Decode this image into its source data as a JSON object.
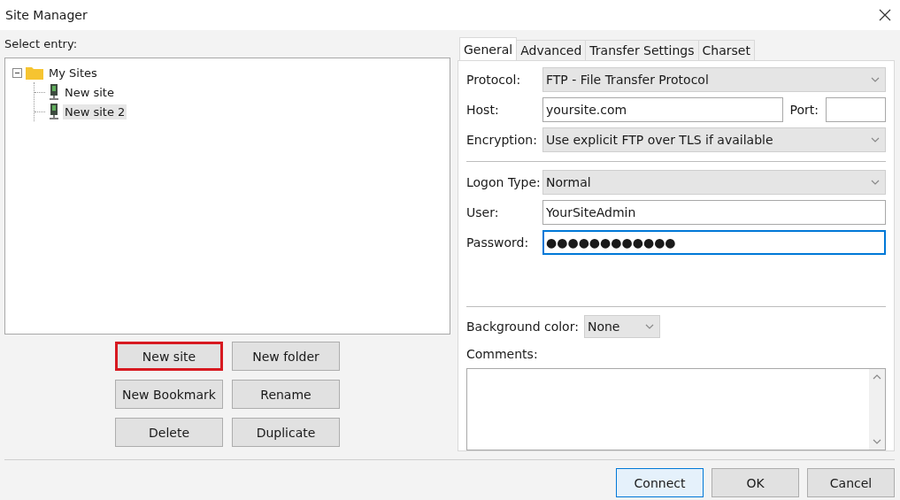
{
  "window": {
    "title": "Site Manager"
  },
  "tree": {
    "label": "Select entry:",
    "items": [
      {
        "label": "My Sites",
        "kind": "folder",
        "expanded": true,
        "selected": false,
        "children": [
          {
            "label": "New site",
            "kind": "site",
            "selected": false
          },
          {
            "label": "New site 2",
            "kind": "site",
            "selected": true
          }
        ]
      }
    ]
  },
  "entry_buttons": [
    {
      "label": "New site",
      "highlighted": true
    },
    {
      "label": "New folder",
      "highlighted": false
    },
    {
      "label": "New Bookmark",
      "highlighted": false
    },
    {
      "label": "Rename",
      "highlighted": false
    },
    {
      "label": "Delete",
      "highlighted": false
    },
    {
      "label": "Duplicate",
      "highlighted": false
    }
  ],
  "tabs": [
    {
      "label": "General",
      "selected": true
    },
    {
      "label": "Advanced",
      "selected": false
    },
    {
      "label": "Transfer Settings",
      "selected": false
    },
    {
      "label": "Charset",
      "selected": false
    }
  ],
  "server_fields": [
    {
      "label": "Protocol:",
      "kind": "select",
      "value": "FTP - File Transfer Protocol"
    },
    {
      "label": "Host:",
      "kind": "input",
      "value": "yoursite.com",
      "extra_label": "Port:"
    },
    {
      "label": "Encryption:",
      "kind": "select",
      "value": "Use explicit FTP over TLS if available"
    }
  ],
  "logon_fields": [
    {
      "label": "Logon Type:",
      "kind": "select",
      "value": "Normal"
    },
    {
      "label": "User:",
      "kind": "input",
      "value": "YourSiteAdmin"
    },
    {
      "label": "Password:",
      "kind": "input",
      "value": "●●●●●●●●●●●●",
      "focused": true
    }
  ],
  "background_color": {
    "label": "Background color:",
    "value": "None"
  },
  "comments": {
    "label": "Comments:"
  },
  "dialog_buttons": [
    {
      "label": "Connect",
      "default": true
    },
    {
      "label": "OK",
      "default": false
    },
    {
      "label": "Cancel",
      "default": false
    }
  ]
}
